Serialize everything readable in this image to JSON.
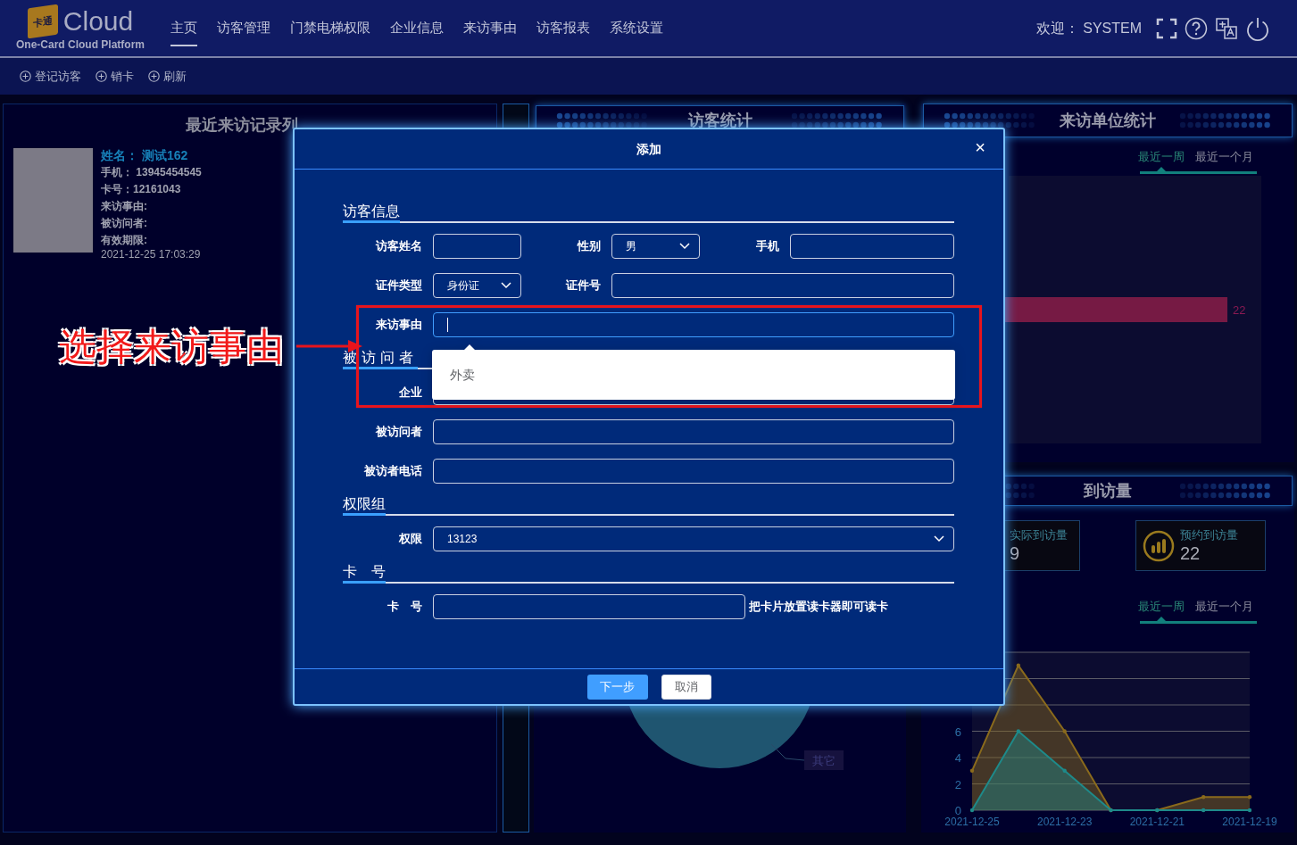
{
  "header": {
    "logo_mark": "卡通",
    "logo_text": "Cloud",
    "tagline": "One-Card Cloud Platform",
    "nav": [
      {
        "label": "主页",
        "selected": true
      },
      {
        "label": "访客管理",
        "selected": false
      },
      {
        "label": "门禁电梯权限",
        "selected": false
      },
      {
        "label": "企业信息",
        "selected": false
      },
      {
        "label": "来访事由",
        "selected": false
      },
      {
        "label": "访客报表",
        "selected": false
      },
      {
        "label": "系统设置",
        "selected": false
      }
    ],
    "welcome": "欢迎：  SYSTEM"
  },
  "toolbar": [
    "登记访客",
    "销卡",
    "刷新"
  ],
  "recent_visits": {
    "title": "最近来访记录列",
    "name": "姓名：  测试162",
    "lines": [
      "手机：  13945454545",
      "卡号：12161043",
      "来访事由:",
      "被访问者:",
      "有效期限:",
      "2021-12-25 17:03:29"
    ]
  },
  "visitor_stats": {
    "title": "访客统计"
  },
  "visit_reason_stats": {
    "pie_label": "其它"
  },
  "unit_stats": {
    "title": "来访单位统计",
    "tabs": [
      {
        "label": "最近一周",
        "selected": true
      },
      {
        "label": "最近一个月",
        "selected": false
      }
    ],
    "bar_label": "22"
  },
  "arrivals": {
    "title": "到访量",
    "cards": [
      {
        "label": "实际到访量",
        "value": "9"
      },
      {
        "label": "预约到访量",
        "value": "22"
      }
    ],
    "tabs": [
      {
        "label": "最近一周",
        "selected": true
      },
      {
        "label": "最近一个月",
        "selected": false
      }
    ],
    "chart_data": {
      "type": "area",
      "categories": [
        "2021-12-25",
        null,
        "2021-12-23",
        null,
        "2021-12-21",
        null,
        "2021-12-19"
      ],
      "series": [
        {
          "color": "#8a6a1c",
          "values": [
            3,
            11,
            6,
            0,
            0,
            1,
            1
          ]
        },
        {
          "color": "#1e8a8a",
          "values": [
            0,
            6,
            3,
            0,
            0,
            0,
            0
          ]
        }
      ],
      "ylim": [
        0,
        12
      ],
      "yticks": [
        0,
        2,
        4,
        6
      ],
      "grid": true
    }
  },
  "dialog": {
    "title": "添加",
    "close": "×",
    "sections": [
      {
        "title": "访客信息",
        "rows": [
          [
            {
              "label": "访客姓名",
              "kind": "input",
              "focused": false
            },
            {
              "label": "性别",
              "kind": "select",
              "value": "男",
              "focused": false
            },
            {
              "label": "手机",
              "kind": "input",
              "focused": false
            }
          ],
          [
            {
              "label": "证件类型",
              "kind": "select",
              "value": "身份证",
              "focused": false
            },
            {
              "label": "证件号",
              "kind": "input",
              "focused": false
            }
          ],
          [
            {
              "label": "来访事由",
              "kind": "input",
              "focused": true
            }
          ]
        ]
      },
      {
        "title": "被访问者",
        "rows": [
          [
            {
              "label": "企业",
              "kind": "input",
              "focused": false
            }
          ],
          [
            {
              "label": "被访问者",
              "kind": "input",
              "focused": false
            }
          ],
          [
            {
              "label": "被访者电话",
              "kind": "input",
              "focused": false
            }
          ]
        ]
      },
      {
        "title": "权限组",
        "rows": [
          [
            {
              "label": "权限",
              "kind": "select",
              "value": "13123",
              "focused": false
            }
          ]
        ]
      },
      {
        "title": "卡　号",
        "rows": [
          [
            {
              "label": "卡　号",
              "kind": "input",
              "focused": false,
              "hint": "把卡片放置读卡器即可读卡"
            }
          ]
        ]
      }
    ],
    "options": [
      "外卖"
    ],
    "buttons": [
      {
        "label": "下一步",
        "kind": "primary"
      },
      {
        "label": "取消",
        "kind": "default"
      }
    ]
  },
  "annotation": {
    "text": "选择来访事由"
  }
}
